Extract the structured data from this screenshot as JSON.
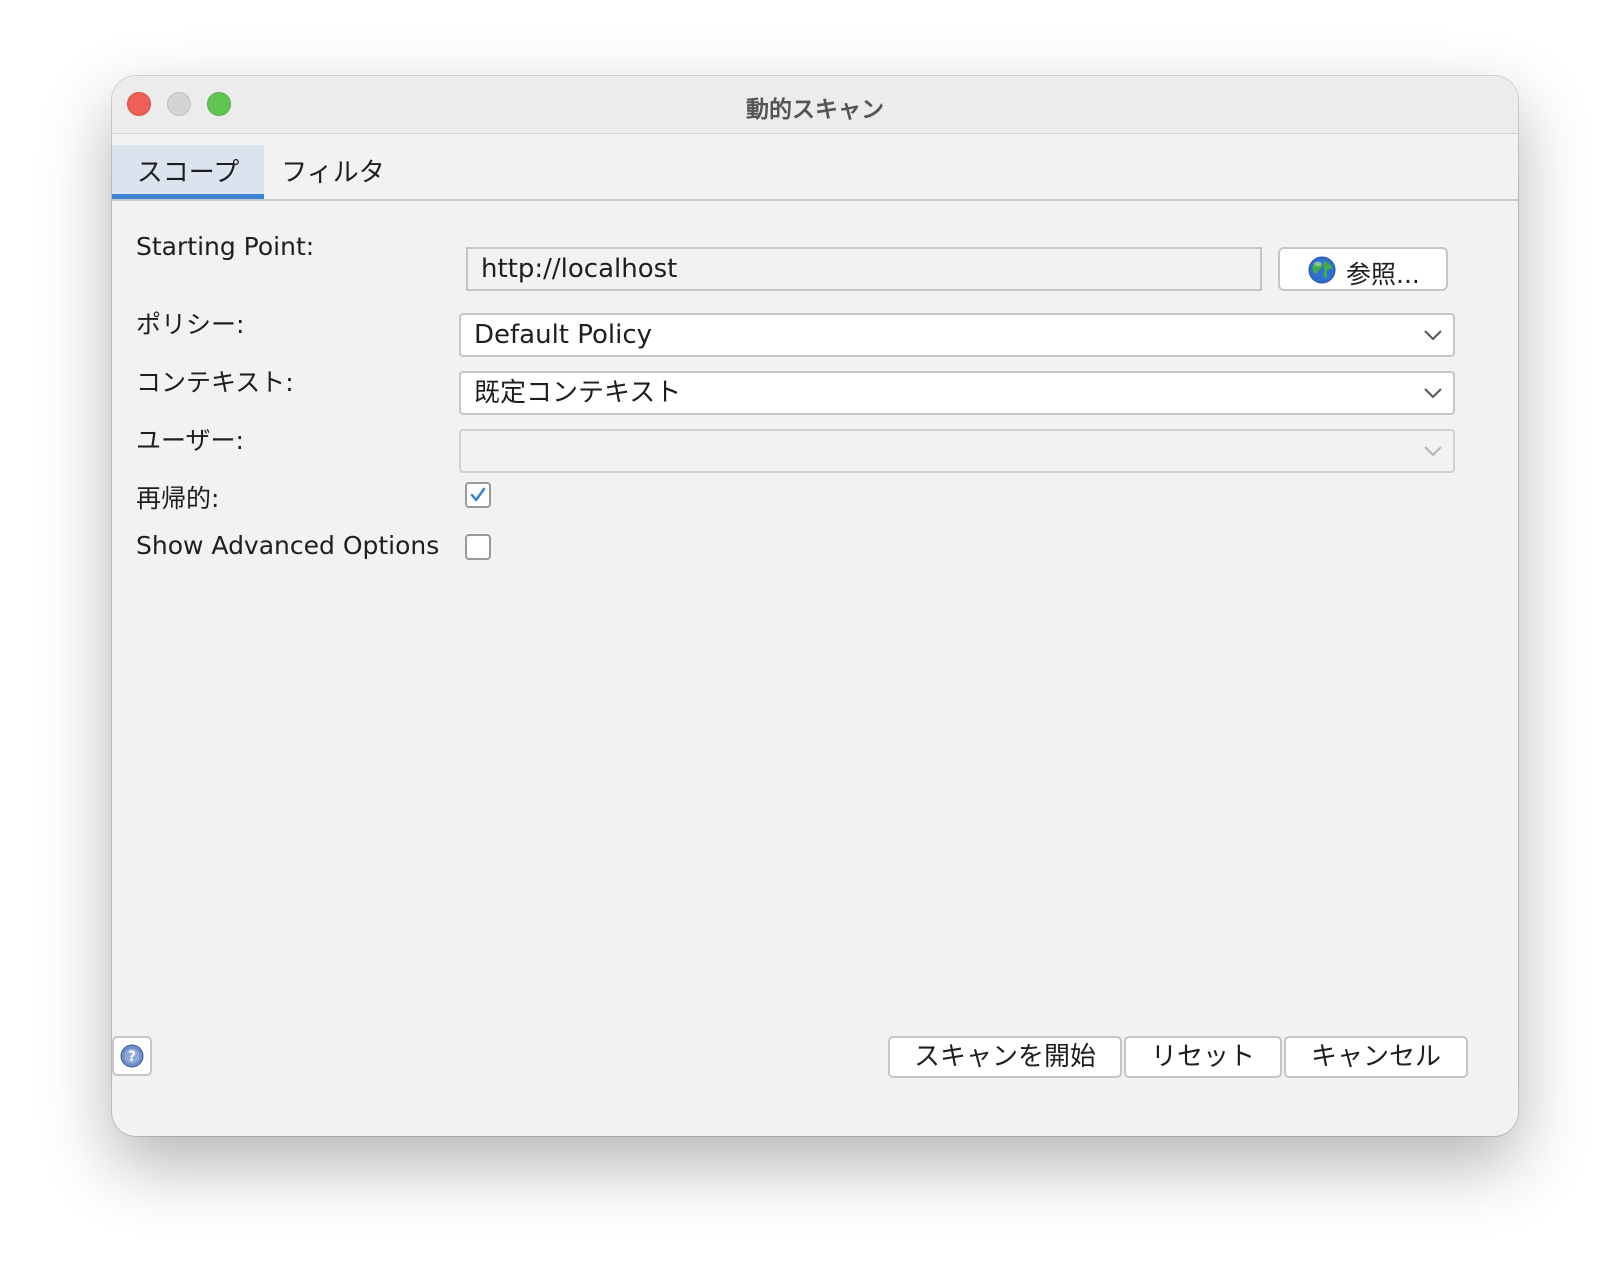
{
  "window": {
    "title": "動的スキャン"
  },
  "tabs": [
    {
      "label": "スコープ",
      "active": true
    },
    {
      "label": "フィルタ",
      "active": false
    }
  ],
  "form": {
    "starting_point": {
      "label": "Starting Point:",
      "value": "http://localhost",
      "browse_label": "参照..."
    },
    "policy": {
      "label": "ポリシー:",
      "selected": "Default Policy"
    },
    "context": {
      "label": "コンテキスト:",
      "selected": "既定コンテキスト"
    },
    "user": {
      "label": "ユーザー:",
      "selected": ""
    },
    "recursive": {
      "label": "再帰的:",
      "checked": true
    },
    "advanced": {
      "label": "Show Advanced Options",
      "checked": false
    }
  },
  "footer": {
    "start_label": "スキャンを開始",
    "reset_label": "リセット",
    "cancel_label": "キャンセル"
  },
  "colors": {
    "accent": "#3b83d4",
    "close": "#ee5f57",
    "minimize": "#d3d3d3",
    "zoom": "#61c554"
  }
}
